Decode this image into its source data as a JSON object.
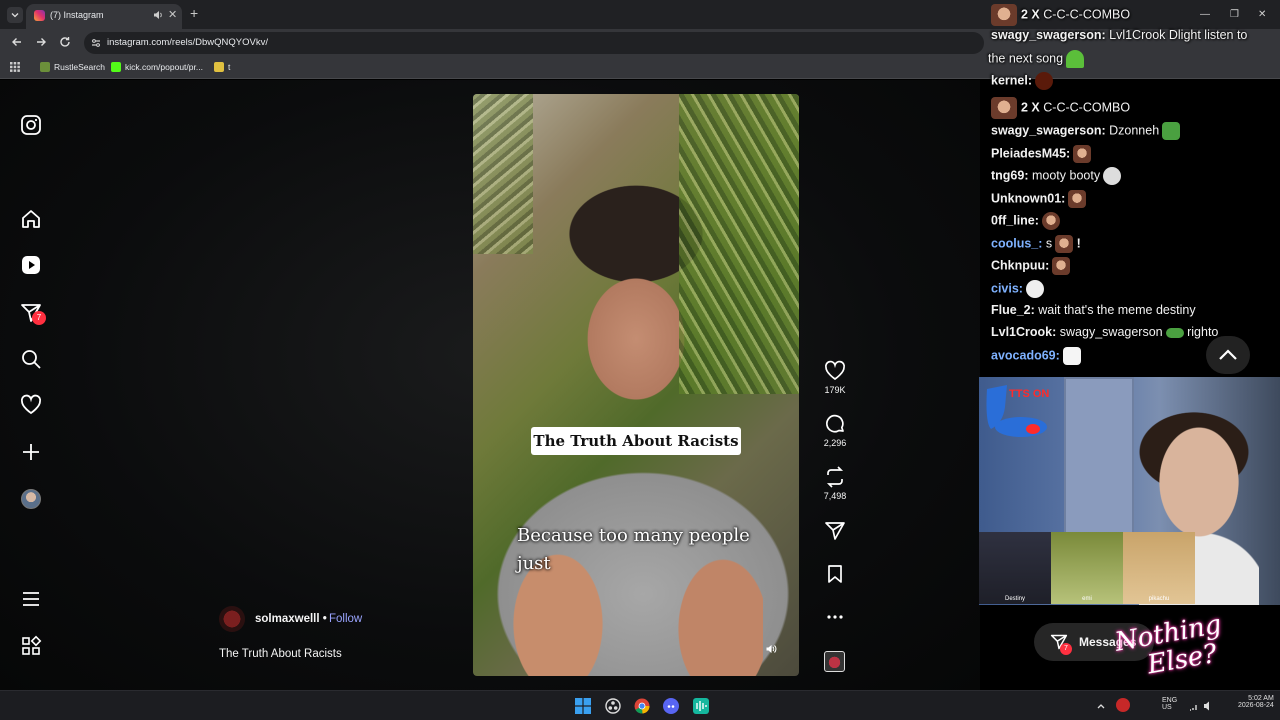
{
  "browser": {
    "tab": {
      "title": "(7) Instagram"
    },
    "url": "instagram.com/reels/DbwQNQYOVkv/",
    "bookmarks": [
      {
        "label": "RustleSearch"
      },
      {
        "label": "kick.com/popout/pr..."
      },
      {
        "label": "t"
      }
    ]
  },
  "sidebar": {
    "notification_count": "7"
  },
  "reel": {
    "title_overlay": "The Truth About Racists",
    "subtitle_overlay": "Because too many people just",
    "author": "solmaxwelll",
    "separator": "•",
    "follow_label": "Follow",
    "description": "The Truth About Racists"
  },
  "actions": {
    "likes": "179K",
    "comments": "2,296",
    "reposts": "7,498"
  },
  "chat": {
    "lines": [
      {
        "user": "2 X",
        "text": "C-C-C-COMBO"
      },
      {
        "user": "swagy_swagerson:",
        "text": "Lvl1Crook Dlight listen to"
      },
      {
        "user": "",
        "text": "the next song"
      },
      {
        "user": "kernel:",
        "text": ""
      },
      {
        "user": "2 X",
        "text": "C-C-C-COMBO"
      },
      {
        "user": "swagy_swagerson:",
        "text": "Dzonneh"
      },
      {
        "user": "PleiadesM45:",
        "text": ""
      },
      {
        "user": "tng69:",
        "text": "mooty booty"
      },
      {
        "user": "Unknown01:",
        "text": ""
      },
      {
        "user": "0ff_line:",
        "text": ""
      },
      {
        "user": "coolus_:",
        "text": "s"
      },
      {
        "user": "Chknpuu:",
        "text": ""
      },
      {
        "user": "civis:",
        "text": ""
      },
      {
        "user": "Flue_2:",
        "text": "wait that's the meme destiny"
      },
      {
        "user": "Lvl1Crook:",
        "text": "swagy_swagerson"
      },
      {
        "user": "avocado69:",
        "text": ""
      }
    ],
    "extra": {
      "coolus_suffix": "!",
      "righto": "righto"
    }
  },
  "webcam": {
    "tts_label": "TTS ON",
    "strip": [
      {
        "label": "Destiny"
      },
      {
        "label": "emi"
      },
      {
        "label": "pikachu"
      }
    ]
  },
  "messages": {
    "label": "Messages",
    "badge": "7"
  },
  "overlay_logo": {
    "line1": "Nothing",
    "line2": "Else?"
  },
  "taskbar": {
    "lang_top": "ENG",
    "lang_bottom": "US",
    "time": "5:02 AM",
    "date": "2026-08-24"
  },
  "colors": {
    "accent_follow": "#9aa4ff",
    "notification_red": "#ff3040",
    "chat_blue_user": "#7fb2ff"
  }
}
